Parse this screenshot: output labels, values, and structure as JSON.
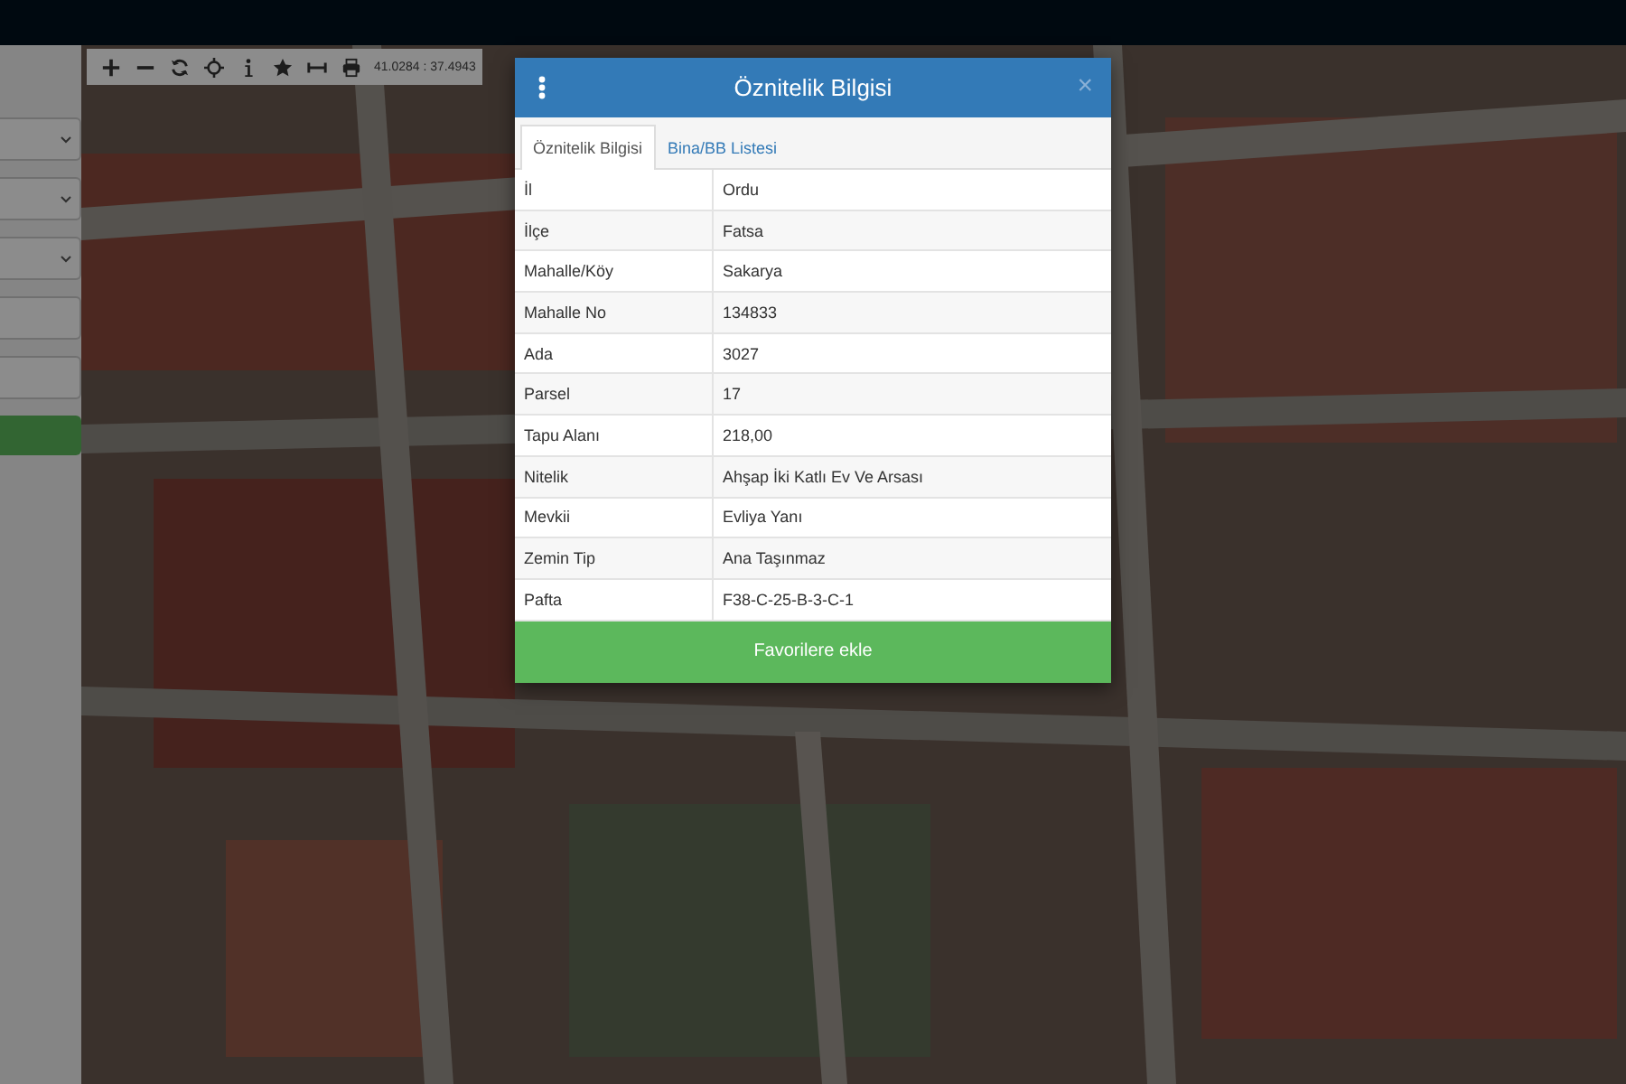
{
  "map_toolbar": {
    "coordinates": "41.0284 : 37.4943"
  },
  "dialog": {
    "title": "Öznitelik Bilgisi",
    "close": "×",
    "tabs": [
      {
        "label": "Öznitelik Bilgisi",
        "selected": true
      },
      {
        "label": "Bina/BB Listesi",
        "selected": false
      }
    ],
    "rows": [
      {
        "label": "İl",
        "value": "Ordu"
      },
      {
        "label": "İlçe",
        "value": "Fatsa"
      },
      {
        "label": "Mahalle/Köy",
        "value": "Sakarya"
      },
      {
        "label": "Mahalle No",
        "value": "134833"
      },
      {
        "label": "Ada",
        "value": "3027"
      },
      {
        "label": "Parsel",
        "value": "17"
      },
      {
        "label": "Tapu Alanı",
        "value": "218,00"
      },
      {
        "label": "Nitelik",
        "value": "Ahşap İki Katlı Ev Ve Arsası"
      },
      {
        "label": "Mevkii",
        "value": "Evliya Yanı"
      },
      {
        "label": "Zemin Tip",
        "value": "Ana Taşınmaz"
      },
      {
        "label": "Pafta",
        "value": "F38-C-25-B-3-C-1"
      }
    ],
    "button": "Favorilere ekle"
  }
}
